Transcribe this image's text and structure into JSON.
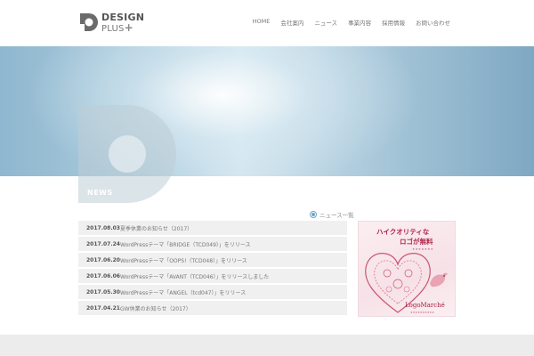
{
  "logo": {
    "line1": "DESIGN",
    "line2": "PLUS",
    "plus": "+"
  },
  "nav": {
    "items": [
      {
        "label": "HOME"
      },
      {
        "label": "会社案内"
      },
      {
        "label": "ニュース"
      },
      {
        "label": "事業内容"
      },
      {
        "label": "採用情報"
      },
      {
        "label": "お問い合わせ"
      }
    ]
  },
  "news": {
    "heading": "NEWS",
    "list_link": "ニュース一覧",
    "items": [
      {
        "date": "2017.08.03",
        "title": "夏季休業のお知らせ（2017）"
      },
      {
        "date": "2017.07.24",
        "title": "WordPressテーマ「BRIDGE（TCD049）」をリリース"
      },
      {
        "date": "2017.06.20",
        "title": "WordPressテーマ「OOPS!（TCD048）」をリリース"
      },
      {
        "date": "2017.06.06",
        "title": "WordPressテーマ「AVANT（TCD046）」をリリースしました"
      },
      {
        "date": "2017.05.30",
        "title": "WordPressテーマ「ANGEL（tcd047）」をリリース"
      },
      {
        "date": "2017.04.21",
        "title": "GW休業のお知らせ（2017）"
      }
    ]
  },
  "banner": {
    "line1": "ハイクオリティな",
    "line2": "ロゴが無料",
    "line3": "★★★★★★★",
    "brand": "LogoMarché",
    "tagline": "★★★★★★★★★★"
  },
  "colors": {
    "accent": "#6aa6c7",
    "banner_red": "#b0254a",
    "row_bg": "#f0f0f0"
  }
}
